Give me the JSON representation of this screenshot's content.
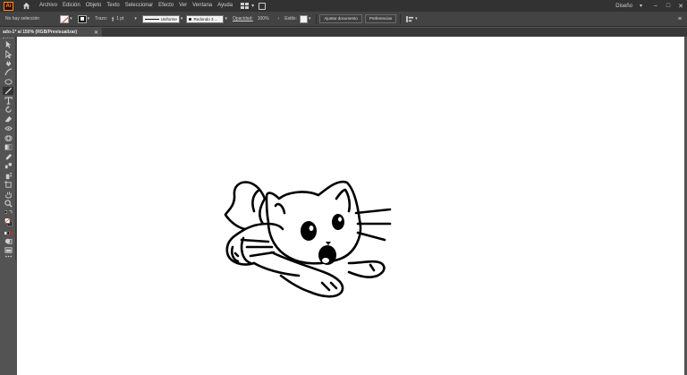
{
  "app": {
    "logo_text": "Ai"
  },
  "menu": {
    "items": [
      "Archivo",
      "Edición",
      "Objeto",
      "Texto",
      "Seleccionar",
      "Efecto",
      "Ver",
      "Ventana",
      "Ayuda"
    ],
    "workspace": "Diseño"
  },
  "window_controls": {
    "minimize": "–",
    "maximize": "□",
    "close": "✕"
  },
  "controlbar": {
    "selection_status": "No hay selección",
    "stroke_label": "Trazo:",
    "stroke_weight": "1 pt",
    "profile_label": "Uniforme",
    "brush_label": "Redondo 3 ...",
    "opacity_label": "Opacidad:",
    "opacity_value": "100%",
    "style_label": "Estilo:",
    "btn_document_setup": "Ajustar documento",
    "btn_preferences": "Preferencias"
  },
  "document": {
    "tab_title": "ado-1* al 150% (RGB/Previsualizar)",
    "close_glyph": "✕"
  },
  "tools": [
    "selection-tool",
    "direct-selection-tool",
    "pen-tool",
    "curvature-tool",
    "ellipse-tool",
    "paintbrush-tool",
    "type-tool",
    "rotate-tool",
    "eraser-tool",
    "width-tool",
    "shape-builder-tool",
    "gradient-tool",
    "eyedropper-tool",
    "blend-tool",
    "symbol-sprayer-tool",
    "artboard-tool",
    "hand-tool",
    "zoom-tool",
    "fill-stroke-swatches",
    "color-mode",
    "draw-mode",
    "screen-mode",
    "more-tools"
  ],
  "colors": {
    "menubar": "#323232",
    "controlbar": "#434343",
    "panel": "#535353",
    "artboard": "#ffffff",
    "drawing_stroke": "#000000"
  }
}
